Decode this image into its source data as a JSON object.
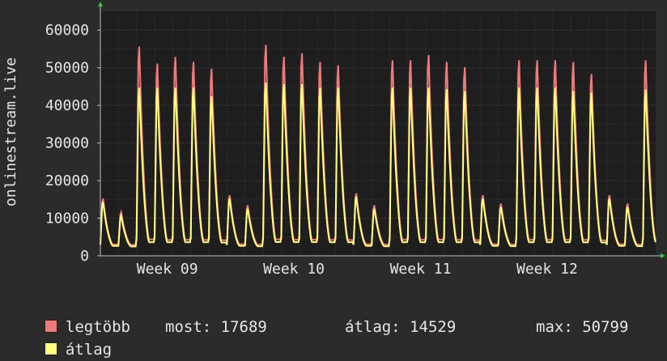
{
  "chart_data": {
    "type": "line",
    "ylabel": "onlinestream.live",
    "yticks": [
      0,
      10000,
      20000,
      30000,
      40000,
      50000,
      60000
    ],
    "ylim": [
      0,
      65000
    ],
    "xticks": [
      "Week 09",
      "Week 10",
      "Week 11",
      "Week 12"
    ],
    "grid": true,
    "legend_placement": "bottom-left",
    "series": [
      {
        "name": "legtöbb",
        "color": "#f07a7a",
        "daily_peaks": [
          16500,
          12500,
          61000,
          56000,
          58000,
          56500,
          54500,
          17500,
          14500,
          61500,
          58000,
          59000,
          56500,
          55500,
          18000,
          14500,
          57000,
          57000,
          58500,
          56500,
          55000,
          17500,
          15000,
          57000,
          57000,
          57000,
          56500,
          53000,
          17500,
          15000,
          57000
        ]
      },
      {
        "name": "átlag",
        "color": "#ffff80",
        "daily_peaks": [
          15500,
          11500,
          49000,
          49000,
          49000,
          49000,
          46500,
          16500,
          13500,
          50500,
          50000,
          50000,
          49000,
          49000,
          17000,
          13500,
          49000,
          49000,
          49000,
          48500,
          48000,
          16500,
          14000,
          49000,
          49000,
          49000,
          48000,
          47500,
          16500,
          14000,
          48500
        ]
      }
    ]
  },
  "legend": [
    {
      "label": "legtöbb",
      "color": "#f07a7a"
    },
    {
      "label": "átlag",
      "color": "#ffff80"
    }
  ],
  "stats": {
    "most": "most: 17689",
    "atlag": "átlag: 14529",
    "max": "max: 50799"
  }
}
